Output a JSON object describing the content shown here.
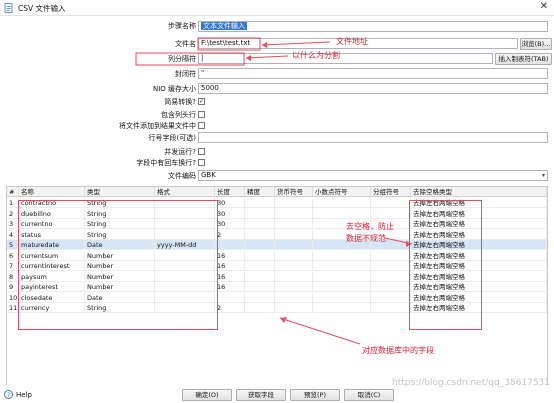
{
  "window": {
    "title": "CSV 文件输入",
    "close_glyph": "✕"
  },
  "form": {
    "step_name_label": "步骤名称",
    "step_name_value": "文本文件输入",
    "filename_label": "文件名",
    "filename_value": "F:\\test\\test.txt",
    "browse_button": "浏览(B)...",
    "delimiter_label": "列分隔符",
    "delimiter_value": "|",
    "insert_tab_button": "插入制表符(TAB)",
    "enclosure_label": "封闭符",
    "enclosure_value": "\"",
    "nio_label": "NIO 缓存大小",
    "nio_value": "5000",
    "lazy_label": "简易转换?",
    "lazy_checked": "✓",
    "header_label": "包含列头行",
    "add_filename_label": "将文件添加到结果文件中",
    "rownum_label": "行号字段(可选)",
    "parallel_label": "并发运行?",
    "newline_label": "字段中有回车换行?",
    "encoding_label": "文件编码",
    "encoding_value": "GBK",
    "encoding_arrow": "▾"
  },
  "annotations": {
    "filepath_note": "文件地址",
    "delimiter_note": "以什么为分割",
    "trim_note_1": "去空格，防止",
    "trim_note_2": "数据不规范",
    "db_fields_note": "对应数据库中的字段"
  },
  "table": {
    "headers": [
      "#",
      "名称",
      "类型",
      "格式",
      "长度",
      "精度",
      "货币符号",
      "小数点符号",
      "分组符号",
      "去除空格类型"
    ],
    "rows": [
      [
        "1",
        "contractno",
        "String",
        "",
        "30",
        "",
        "",
        "",
        "",
        "去掉左右两端空格"
      ],
      [
        "2",
        "duebillno",
        "String",
        "",
        "30",
        "",
        "",
        "",
        "",
        "去掉左右两端空格"
      ],
      [
        "3",
        "currentno",
        "String",
        "",
        "30",
        "",
        "",
        "",
        "",
        "去掉左右两端空格"
      ],
      [
        "4",
        "status",
        "String",
        "",
        "2",
        "",
        "",
        "",
        "",
        "去掉左右两端空格"
      ],
      [
        "5",
        "maturedate",
        "Date",
        "yyyy-MM-dd",
        "",
        "",
        "",
        "",
        "",
        "去掉左右两端空格"
      ],
      [
        "6",
        "currentsum",
        "Number",
        "",
        "16",
        "",
        "",
        "",
        "",
        "去掉左右两端空格"
      ],
      [
        "7",
        "currentinterest",
        "Number",
        "",
        "16",
        "",
        "",
        "",
        "",
        "去掉左右两端空格"
      ],
      [
        "8",
        "paysum",
        "Number",
        "",
        "16",
        "",
        "",
        "",
        "",
        "去掉左右两端空格"
      ],
      [
        "9",
        "payinterest",
        "Number",
        "",
        "16",
        "",
        "",
        "",
        "",
        "去掉左右两端空格"
      ],
      [
        "10",
        "closedate",
        "Date",
        "",
        "",
        "",
        "",
        "",
        "",
        "去掉左右两端空格"
      ],
      [
        "11",
        "currency",
        "String",
        "",
        "2",
        "",
        "",
        "",
        "",
        "去掉左右两端空格"
      ]
    ]
  },
  "footer": {
    "help_label": "Help",
    "ok_button": "确定(O)",
    "get_fields_button": "获取字段",
    "preview_button": "预览(P)",
    "cancel_button": "取消(C)",
    "watermark": "https://blog.csdn.net/qq_38617531"
  },
  "colors": {
    "annotation": "#e21b2e",
    "selection": "#3478d0",
    "highlight_row": "#d6e6f6"
  },
  "icons": [
    "csv-file-icon",
    "close-icon",
    "check-icon",
    "help-icon",
    "dropdown-arrow-icon"
  ]
}
